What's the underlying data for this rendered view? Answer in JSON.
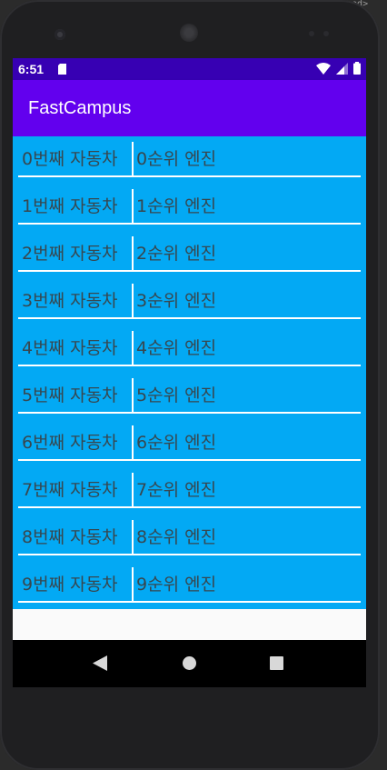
{
  "ide_fragment": "amed>",
  "status_bar": {
    "time": "6:51",
    "icons": [
      "sd-card-icon",
      "wifi-icon",
      "signal-icon",
      "battery-icon"
    ]
  },
  "app_bar": {
    "title": "FastCampus"
  },
  "list": {
    "rows": [
      {
        "car": "0번째 자동차",
        "engine": "0순위 엔진"
      },
      {
        "car": "1번째 자동차",
        "engine": "1순위 엔진"
      },
      {
        "car": "2번째 자동차",
        "engine": "2순위 엔진"
      },
      {
        "car": "3번째 자동차",
        "engine": "3순위 엔진"
      },
      {
        "car": "4번째 자동차",
        "engine": "4순위 엔진"
      },
      {
        "car": "5번째 자동차",
        "engine": "5순위 엔진"
      },
      {
        "car": "6번째 자동차",
        "engine": "6순위 엔진"
      },
      {
        "car": "7번째 자동차",
        "engine": "7순위 엔진"
      },
      {
        "car": "8번째 자동차",
        "engine": "8순위 엔진"
      },
      {
        "car": "9번째 자동차",
        "engine": "9순위 엔진"
      }
    ]
  },
  "nav_bar": {
    "buttons": [
      "back-icon",
      "home-icon",
      "recents-icon"
    ]
  },
  "colors": {
    "status_bar": "#3700b3",
    "app_bar": "#6200ee",
    "list_background": "#03a9f4",
    "list_text": "#37474f",
    "divider": "#ffffff"
  }
}
